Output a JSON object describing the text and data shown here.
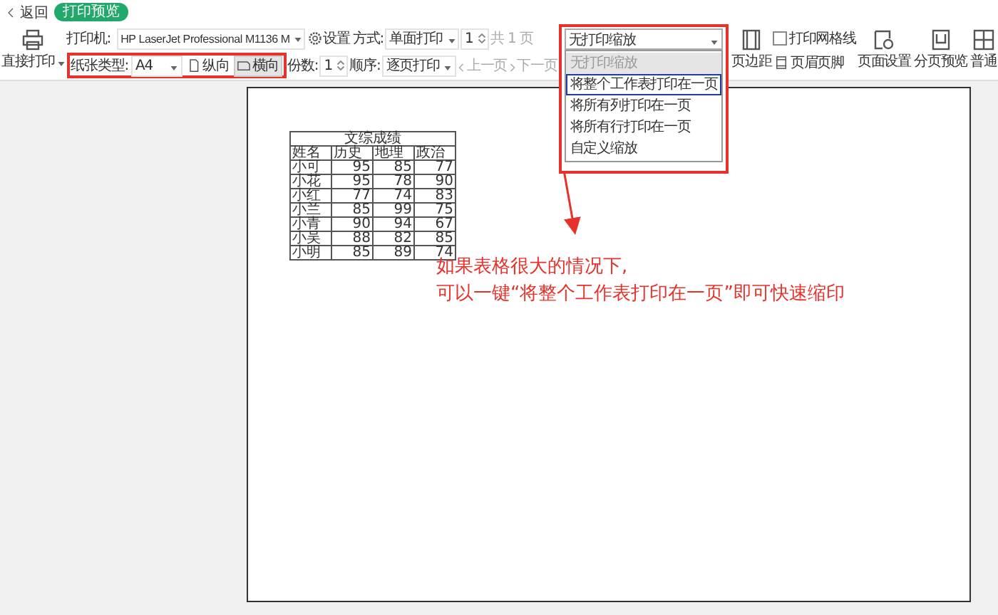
{
  "top_bar": {
    "back": "返回",
    "tab": "打印预览"
  },
  "toolbar": {
    "direct_print": "直接打印",
    "printer_label": "打印机:",
    "printer": "HP LaserJet Professional M1136 M",
    "settings": "设置",
    "mode_label": "方式:",
    "mode": "单面打印",
    "page": "1",
    "page_total": "共 1 页",
    "paper_label": "纸张类型:",
    "paper": "A4",
    "orientations": [
      {
        "label": "纵向",
        "selected": false
      },
      {
        "label": "横向",
        "selected": true
      }
    ],
    "copies_label": "份数:",
    "copies": "1",
    "order_label": "顺序:",
    "order": "逐页打印",
    "prev": "上一页",
    "next": "下一页",
    "scale": "无打印缩放",
    "scale_options": [
      {
        "label": "无打印缩放",
        "current": true,
        "selected": false
      },
      {
        "label": "将整个工作表打印在一页",
        "current": false,
        "selected": true
      },
      {
        "label": "将所有列打印在一页",
        "current": false,
        "selected": false
      },
      {
        "label": "将所有行打印在一页",
        "current": false,
        "selected": false
      },
      {
        "label": "自定义缩放",
        "current": false,
        "selected": false
      }
    ],
    "margins": "页边距",
    "gridlines": {
      "label": "打印网格线",
      "checked": false
    },
    "header_footer": "页眉页脚",
    "page_setup": "页面设置",
    "page_break": "分页预览",
    "normal": "普通"
  },
  "sheet": {
    "title": "文综成绩",
    "columns": [
      "姓名",
      "历史",
      "地理",
      "政治"
    ],
    "rows": [
      [
        "小可",
        "95",
        "85",
        "77"
      ],
      [
        "小花",
        "95",
        "78",
        "90"
      ],
      [
        "小红",
        "77",
        "74",
        "83"
      ],
      [
        "小兰",
        "85",
        "99",
        "75"
      ],
      [
        "小青",
        "90",
        "94",
        "67"
      ],
      [
        "小吴",
        "88",
        "82",
        "85"
      ],
      [
        "小明",
        "85",
        "89",
        "74"
      ]
    ]
  },
  "annotation": {
    "lines": [
      "如果表格很大的情况下,",
      "可以一键“将整个工作表打印在一页”即可快速缩印"
    ]
  }
}
